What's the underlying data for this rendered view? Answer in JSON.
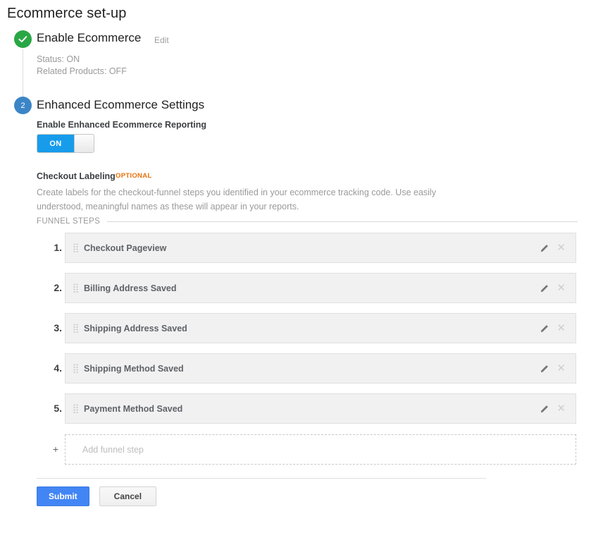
{
  "page": {
    "title": "Ecommerce set-up"
  },
  "step1": {
    "marker_icon": "check-circle-icon",
    "heading": "Enable Ecommerce",
    "edit_link": "Edit",
    "status_line1": "Status: ON",
    "status_line2": "Related Products: OFF"
  },
  "step2": {
    "marker_number": "2",
    "heading": "Enhanced Ecommerce Settings",
    "reporting_label": "Enable Enhanced Ecommerce Reporting",
    "toggle": {
      "state_label": "ON",
      "on_color": "#179cec"
    },
    "checkout": {
      "label": "Checkout Labeling",
      "badge": "OPTIONAL",
      "badge_color": "#e8710a",
      "description": "Create labels for the checkout-funnel steps you identified in your ecommerce tracking code. Use easily understood, meaningful names as these will appear in your reports."
    },
    "funnel": {
      "section_header": "FUNNEL STEPS",
      "steps": [
        {
          "number": "1.",
          "name": "Checkout Pageview"
        },
        {
          "number": "2.",
          "name": "Billing Address Saved"
        },
        {
          "number": "3.",
          "name": "Shipping Address Saved"
        },
        {
          "number": "4.",
          "name": "Shipping Method Saved"
        },
        {
          "number": "5.",
          "name": "Payment Method Saved"
        }
      ],
      "add_plus": "+",
      "add_placeholder": "Add funnel step",
      "row_edit_icon": "pencil-icon",
      "row_delete_icon": "close-icon",
      "row_drag_icon": "drag-handle-icon"
    }
  },
  "footer": {
    "submit_label": "Submit",
    "cancel_label": "Cancel",
    "submit_color": "#4285f4"
  }
}
